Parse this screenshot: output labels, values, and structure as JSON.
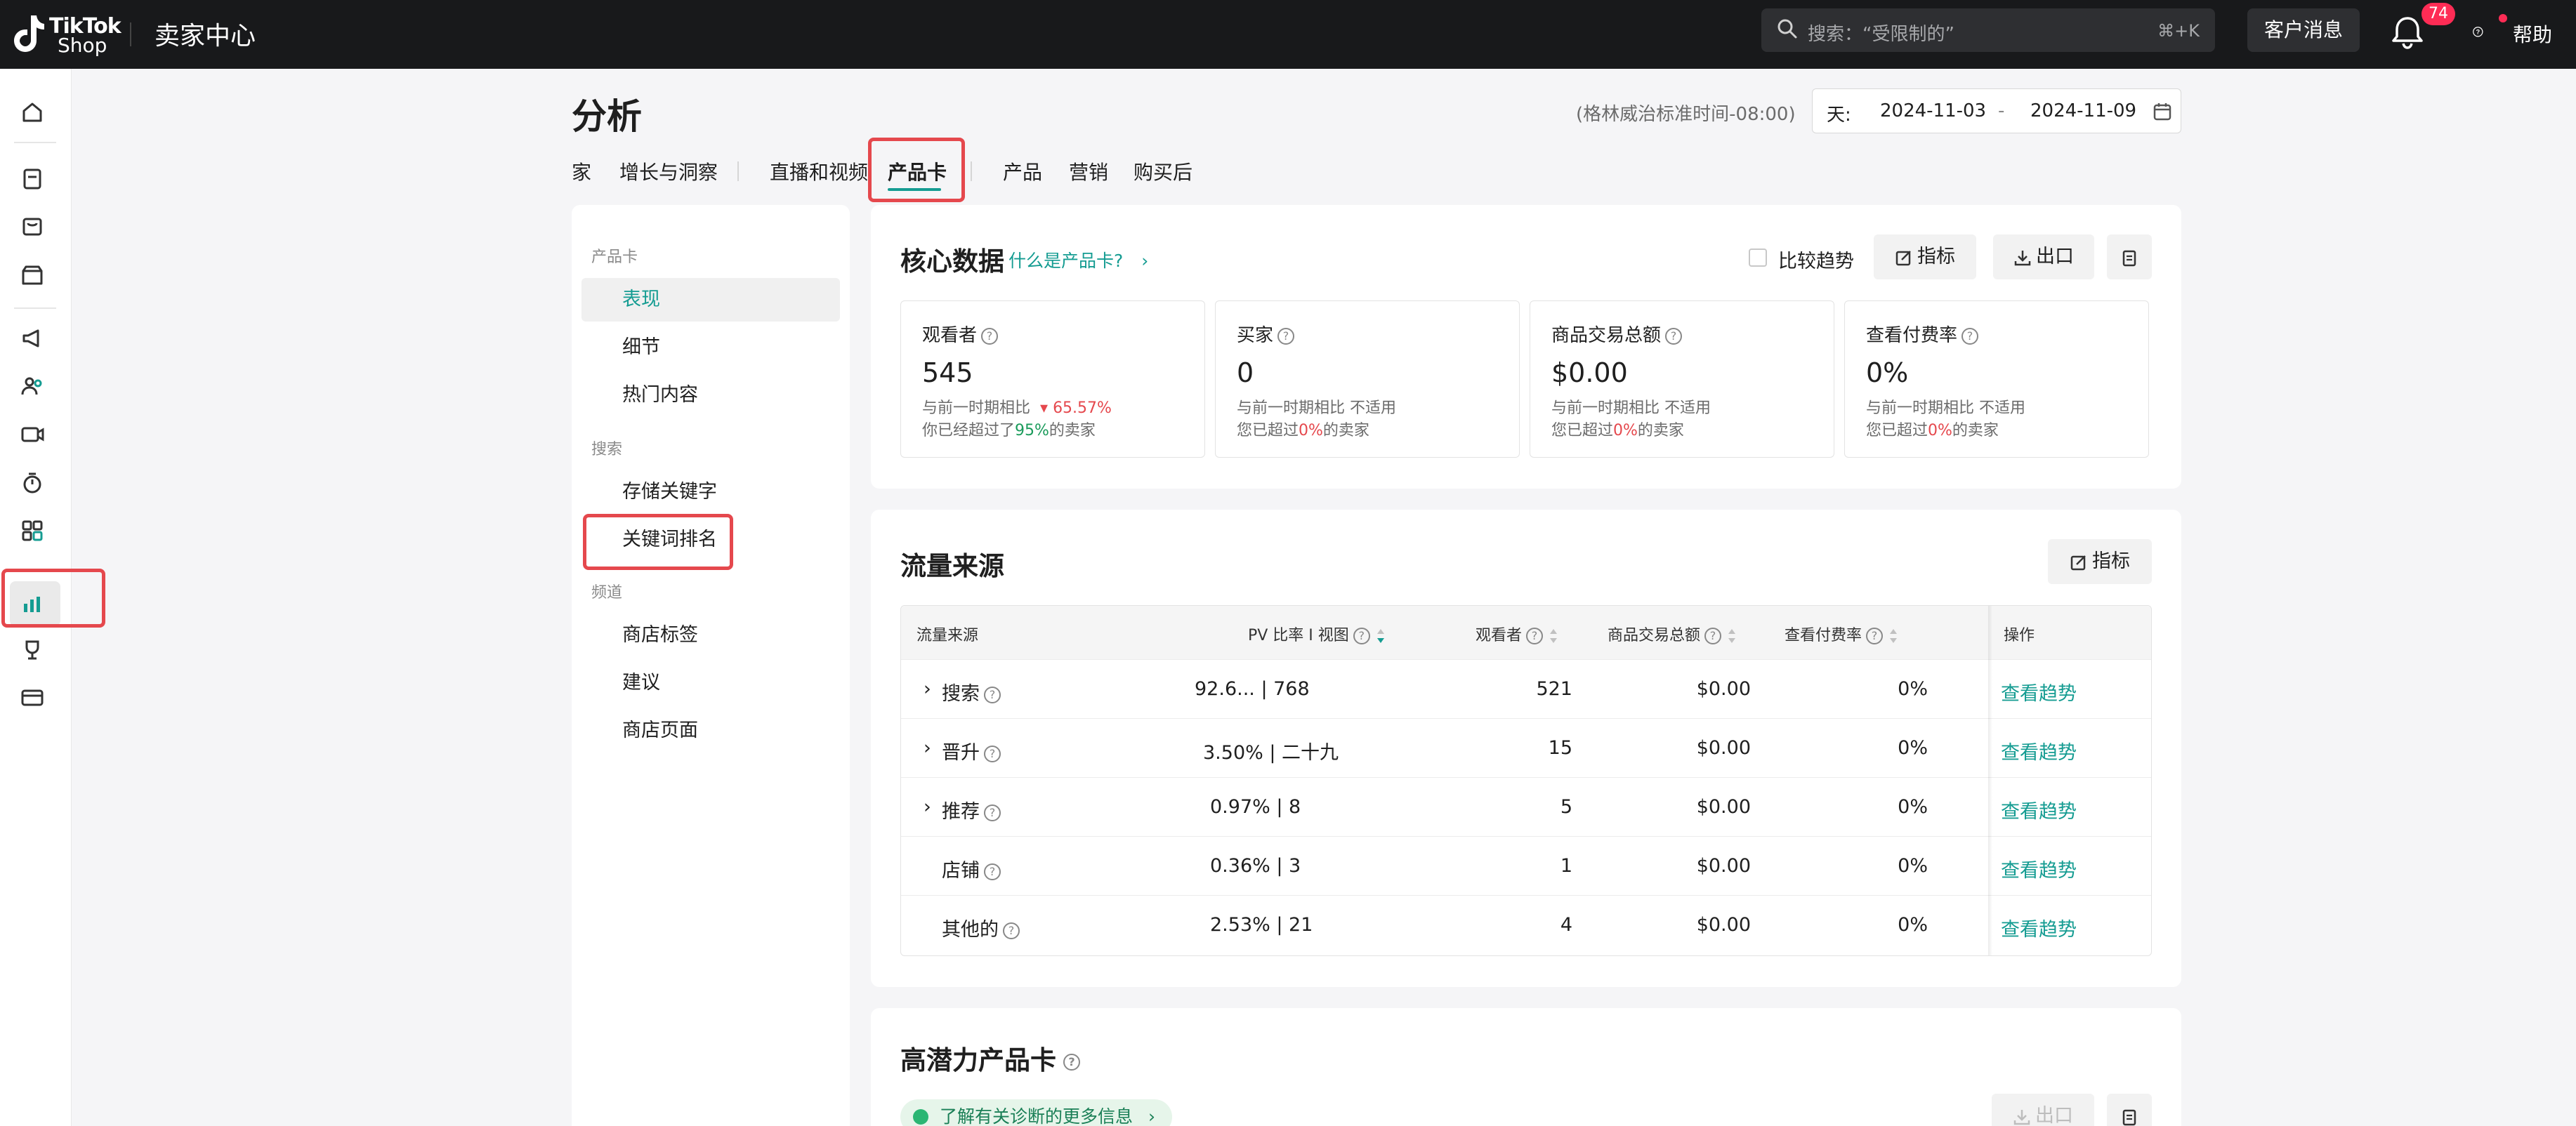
{
  "topbar": {
    "logo_line1": "TikTok",
    "logo_line2": "Shop",
    "app_title": "卖家中心",
    "search_placeholder": "搜索：“受限制的”",
    "search_shortcut": "⌘+K",
    "customer_messages": "客户消息",
    "notification_count": "74",
    "help": "帮助"
  },
  "page": {
    "title": "分析",
    "timezone": "(格林威治标准时间-08:00)",
    "date_granularity": "天:",
    "date_start": "2024-11-03",
    "date_separator": "-",
    "date_end": "2024-11-09"
  },
  "tabs": [
    "家",
    "增长与洞察",
    "直播和视频",
    "产品卡",
    "产品",
    "营销",
    "购买后"
  ],
  "active_tab": "产品卡",
  "side_menu": {
    "groups": [
      {
        "label": "产品卡",
        "items": [
          "表现",
          "细节",
          "热门内容"
        ]
      },
      {
        "label": "搜索",
        "items": [
          "存储关键字",
          "关键词排名"
        ]
      },
      {
        "label": "频道",
        "items": [
          "商店标签",
          "建议",
          "商店页面"
        ]
      }
    ],
    "active_item": "表现"
  },
  "core": {
    "title": "核心数据",
    "what_link": "什么是产品卡?",
    "compare_label": "比较趋势",
    "metrics_btn": "指标",
    "export_btn": "出口",
    "metrics": [
      {
        "name": "观看者",
        "value": "545",
        "line1_prefix": "与前一时期相比",
        "line1_change": "65.57%",
        "line2_prefix": "你已经超过了",
        "line2_pct": "95%",
        "line2_suffix": "的卖家"
      },
      {
        "name": "买家",
        "value": "0",
        "line1_prefix": "与前一时期相比",
        "line1_change": "不适用",
        "line2_prefix": "您已超过",
        "line2_pct": "0%",
        "line2_suffix": "的卖家"
      },
      {
        "name": "商品交易总额",
        "value": "$0.00",
        "line1_prefix": "与前一时期相比",
        "line1_change": "不适用",
        "line2_prefix": "您已超过",
        "line2_pct": "0%",
        "line2_suffix": "的卖家"
      },
      {
        "name": "查看付费率",
        "value": "0%",
        "line1_prefix": "与前一时期相比",
        "line1_change": "不适用",
        "line2_prefix": "您已超过",
        "line2_pct": "0%",
        "line2_suffix": "的卖家"
      }
    ]
  },
  "traffic": {
    "title": "流量来源",
    "metrics_btn": "指标",
    "columns": [
      "流量来源",
      "PV 比率 I 视图",
      "观看者",
      "商品交易总额",
      "查看付费率",
      "操作"
    ],
    "rows": [
      {
        "source": "搜索",
        "expandable": true,
        "pv": "92.6...  | 768",
        "viewers": "521",
        "gmv": "$0.00",
        "rate": "0%",
        "action": "查看趋势"
      },
      {
        "source": "晋升",
        "expandable": true,
        "pv": "3.50% | 二十九",
        "viewers": "15",
        "gmv": "$0.00",
        "rate": "0%",
        "action": "查看趋势"
      },
      {
        "source": "推荐",
        "expandable": true,
        "pv": "0.97% | 8",
        "viewers": "5",
        "gmv": "$0.00",
        "rate": "0%",
        "action": "查看趋势"
      },
      {
        "source": "店铺",
        "expandable": false,
        "pv": "0.36% | 3",
        "viewers": "1",
        "gmv": "$0.00",
        "rate": "0%",
        "action": "查看趋势"
      },
      {
        "source": "其他的",
        "expandable": false,
        "pv": "2.53% | 21",
        "viewers": "4",
        "gmv": "$0.00",
        "rate": "0%",
        "action": "查看趋势"
      }
    ]
  },
  "potential": {
    "title": "高潜力产品卡",
    "diagnosis_link": "了解有关诊断的更多信息",
    "export_btn": "出口"
  },
  "colors": {
    "accent": "#159c92",
    "highlight": "#e5484d",
    "topbar": "#18191b"
  }
}
